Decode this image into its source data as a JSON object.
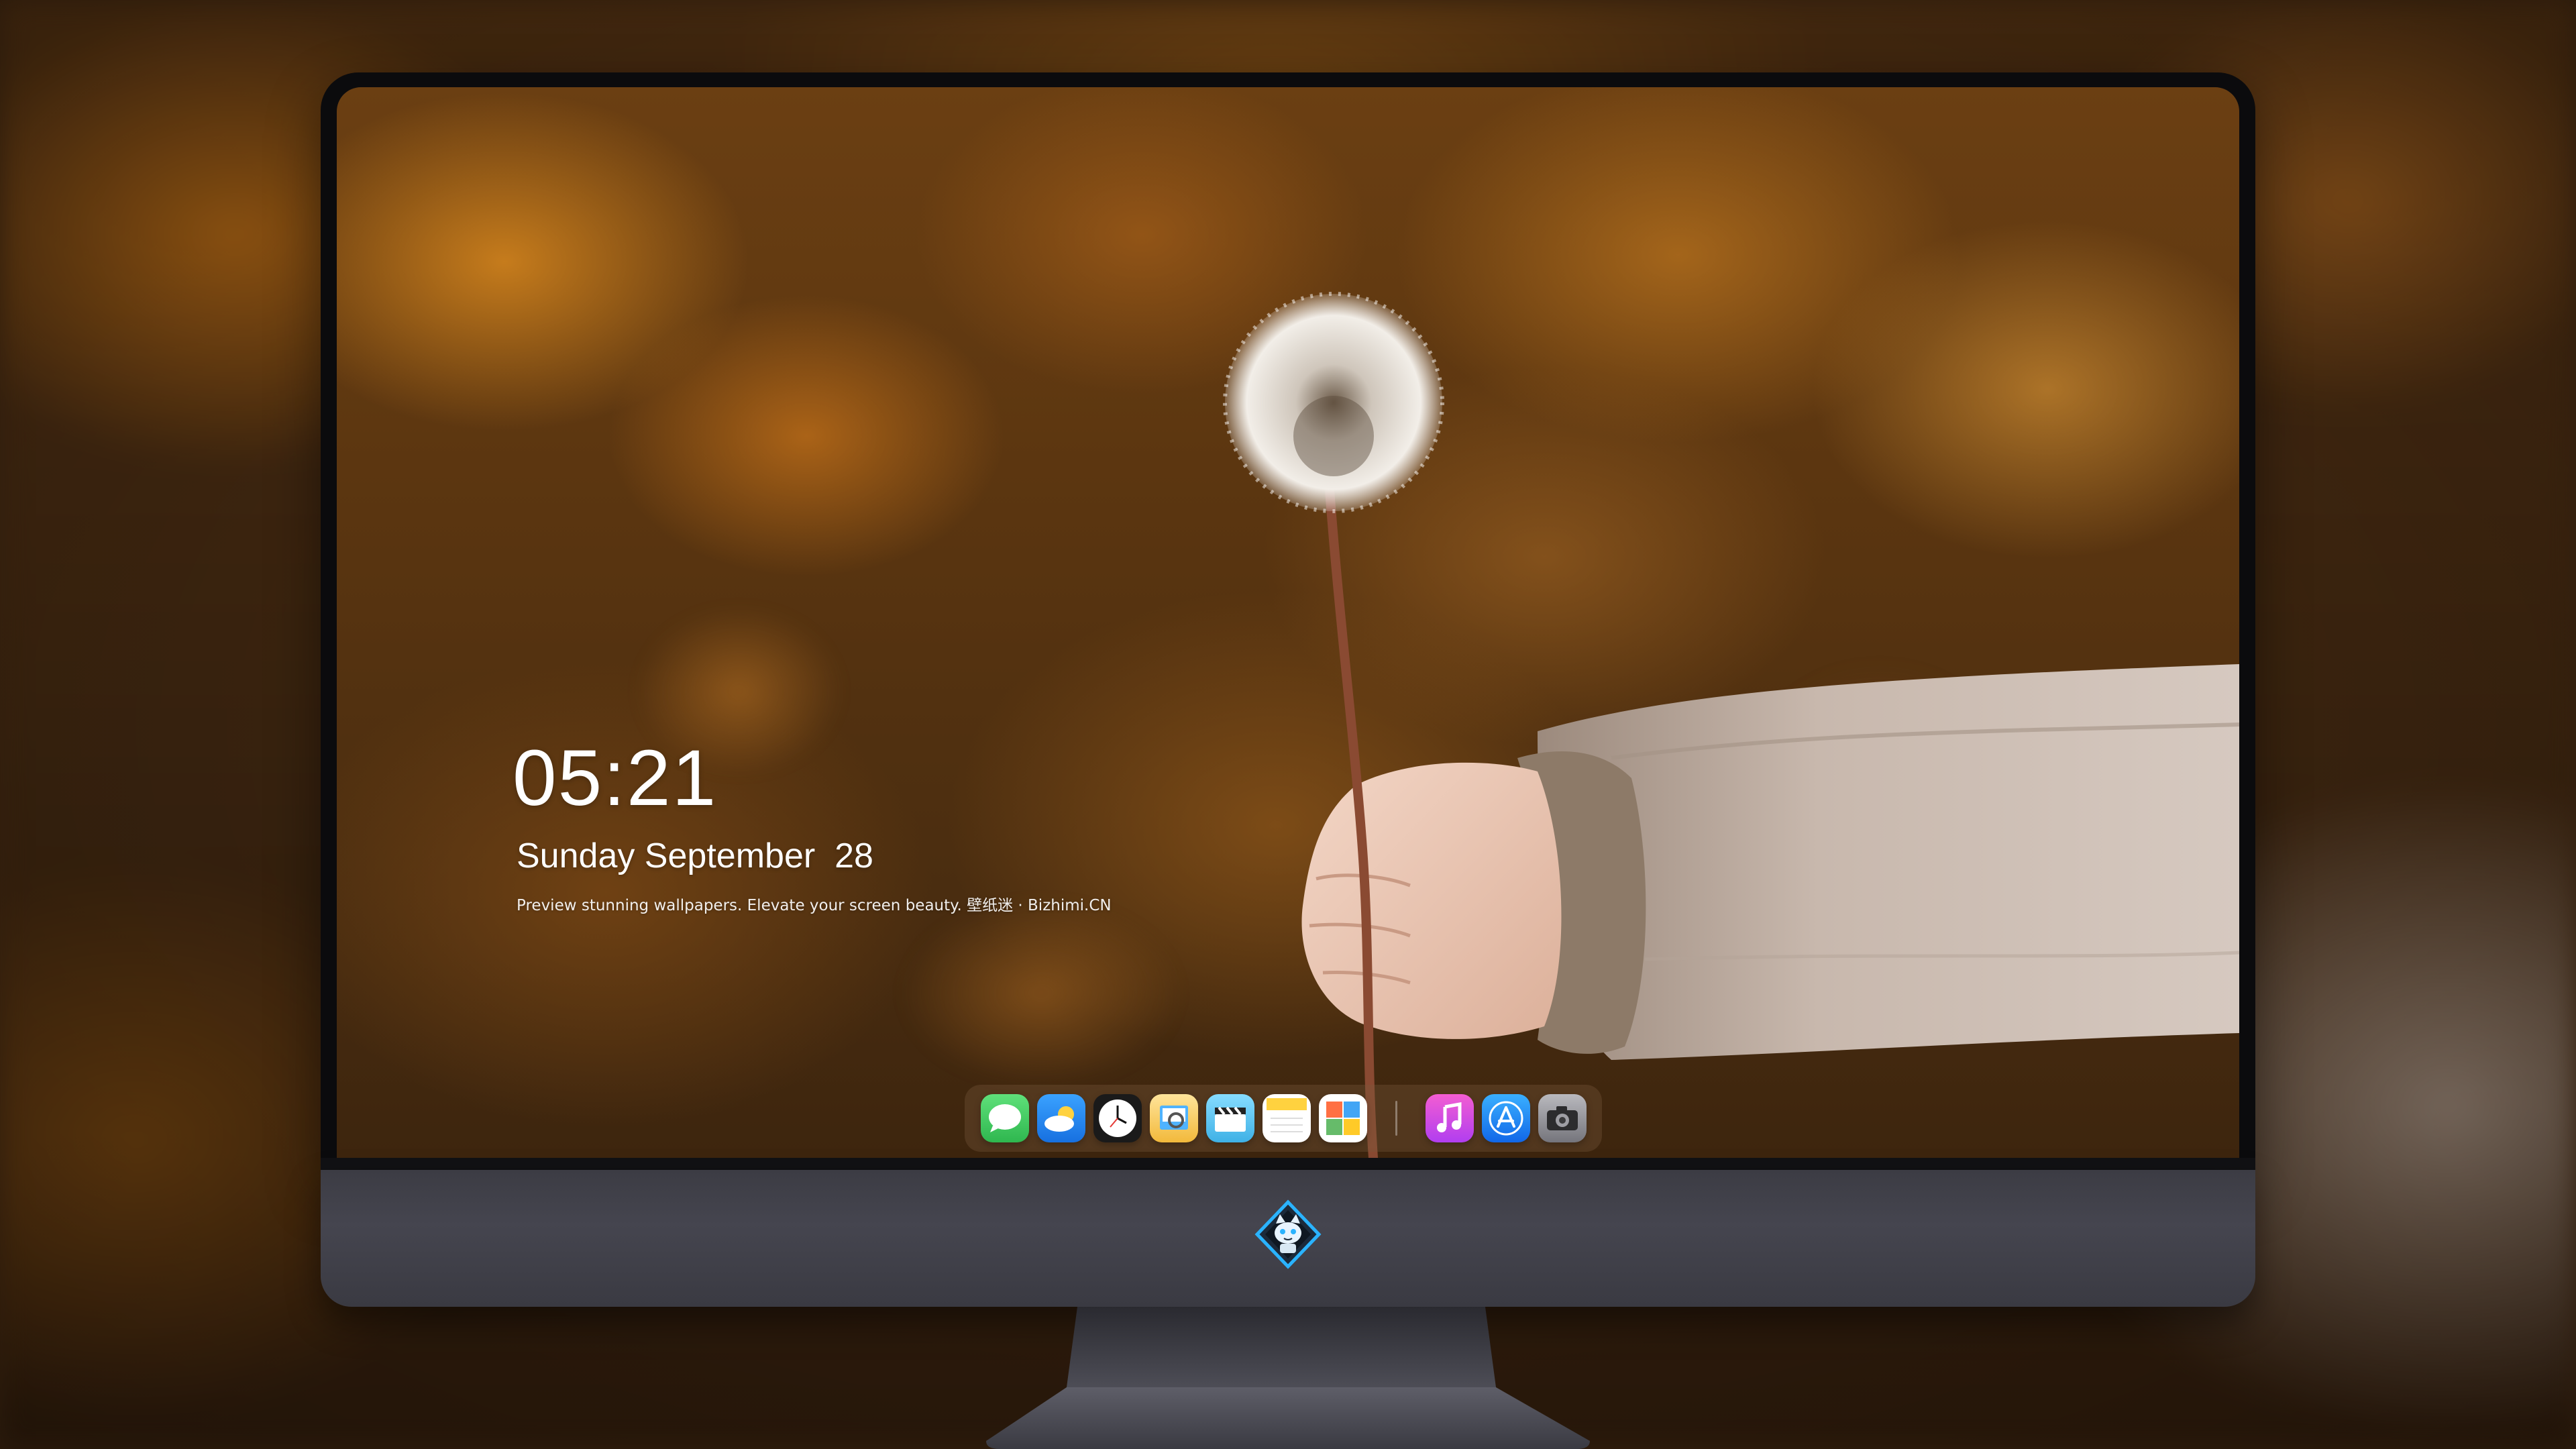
{
  "lock_screen": {
    "time": "05:21",
    "date": "Sunday September  28",
    "tagline": "Preview stunning wallpapers. Elevate your screen beauty. 壁纸迷 · Bizhimi.CN"
  },
  "dock": {
    "apps": [
      {
        "name": "messages-icon",
        "color": "#34c759"
      },
      {
        "name": "weather-icon",
        "color": "#1e90ff"
      },
      {
        "name": "clock-icon",
        "color": "#111111"
      },
      {
        "name": "preview-icon",
        "color": "#f5c84b"
      },
      {
        "name": "claquette-icon",
        "color": "#5ec8f0"
      },
      {
        "name": "notes-icon",
        "color": "#fcd34d"
      },
      {
        "name": "photo-grid-icon",
        "color": "#4caf50"
      },
      {
        "name": "music-icon",
        "color": "#e040fb"
      },
      {
        "name": "app-store-icon",
        "color": "#1d8cf8"
      },
      {
        "name": "camera-icon",
        "color": "#8e8e93"
      }
    ]
  },
  "brand": {
    "logo_icon": "fox-mascot-logo-icon",
    "accent": "#2ab3ff"
  }
}
